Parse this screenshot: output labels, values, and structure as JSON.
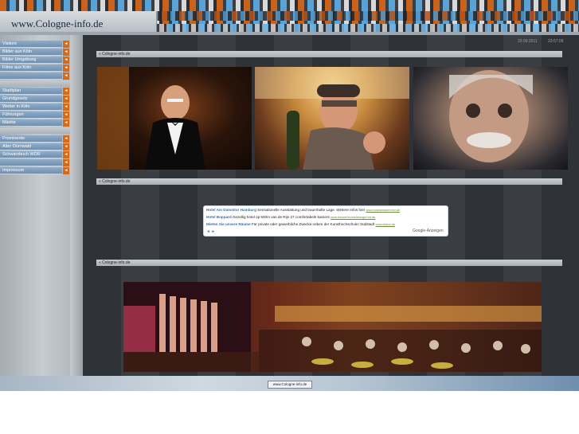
{
  "header": {
    "site_title": "www.Cologne-info.de"
  },
  "sidebar": {
    "group1": [
      {
        "label": "Visitors"
      },
      {
        "label": "Bilder aus Köln"
      },
      {
        "label": "Bilder Umgebung"
      },
      {
        "label": "Filme aus Köln"
      },
      {
        "label": ""
      }
    ],
    "group2": [
      {
        "label": "Stadtplan"
      },
      {
        "label": "Grundgesetz"
      },
      {
        "label": "Wetter in Köln"
      },
      {
        "label": "Führungen"
      },
      {
        "label": "Märkte"
      }
    ],
    "group3": [
      {
        "label": "Prominente"
      },
      {
        "label": "Alter Dürnwald"
      },
      {
        "label": "Schwarzbuch WDR"
      },
      {
        "label": ""
      }
    ],
    "group4": [
      {
        "label": "Impressum"
      }
    ],
    "arrow_glyph": "◄"
  },
  "main": {
    "date": "20.09.2011",
    "time": "23:57:09",
    "sections": [
      "« Cologne-info.de",
      "« Cologne-info.de",
      "« Cologne-info.de"
    ]
  },
  "ads": [
    {
      "title": "Hotel Am Dammtor Hamburg",
      "text": "Sensationelle Ausstattung und traumhafte Lage. Weitere Infos hier",
      "url": "www.hotelamdammtor.de"
    },
    {
      "title": "Hotel Boppard",
      "text": "Gezellig hotel op 500m van de Rijn 27 comfortabele kamers",
      "url": "www.besserhimmelsbergerhof.de"
    },
    {
      "title": "Mieten Sie unsere Räume",
      "text": "Für private oder gewerbliche Zwecke neben der Kunsthochschule! Südstadt",
      "url": "www.eiland.de"
    }
  ],
  "ad_nav": "◄ ►",
  "ad_footer": "Google-Anzeigen",
  "footer": {
    "button_label": "www.Cologne-info.de"
  }
}
